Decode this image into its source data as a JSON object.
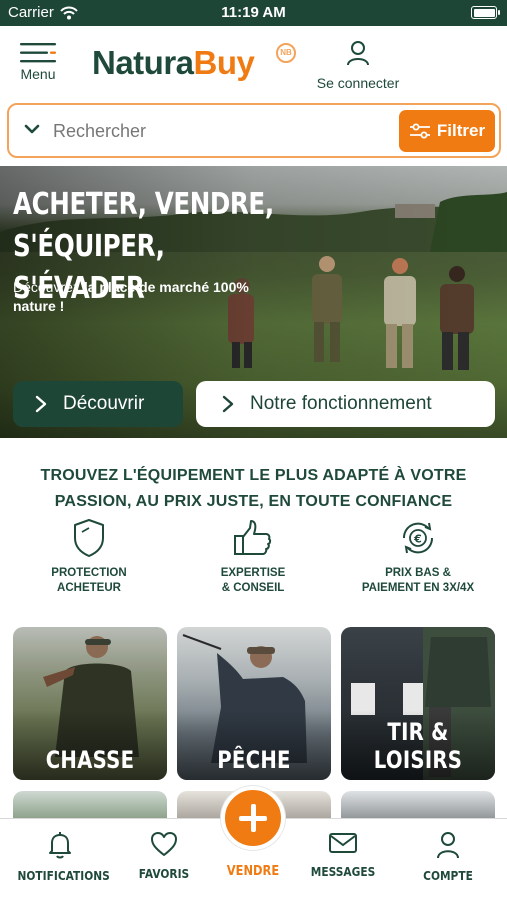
{
  "status_bar": {
    "carrier": "Carrier",
    "time": "11:19 AM",
    "battery_level": 1.0
  },
  "header": {
    "menu_label": "Menu",
    "logo_part1": "Natura",
    "logo_part2": "Buy",
    "logo_badge": "NB",
    "login_label": "Se connecter"
  },
  "search": {
    "placeholder": "Rechercher",
    "value": "",
    "filter_label": "Filtrer"
  },
  "hero": {
    "title_line1": "ACHETER, VENDRE,",
    "title_line2": "S'ÉQUIPER, S'ÉVADER",
    "subtitle_plain": "Découvrez ",
    "subtitle_bold": "la place de marché 100% nature !",
    "btn_discover": "Découvrir",
    "btn_how_it_works": "Notre fonctionnement"
  },
  "tagline": "TROUVEZ L'ÉQUIPEMENT LE PLUS ADAPTÉ À VOTRE PASSION, AU PRIX JUSTE, EN TOUTE CONFIANCE",
  "features": [
    {
      "icon": "shield-icon",
      "label": "PROTECTION\nACHETEUR"
    },
    {
      "icon": "thumbs-up-icon",
      "label": "EXPERTISE\n& CONSEIL"
    },
    {
      "icon": "euro-cycle-icon",
      "label": "PRIX BAS &\nPAIEMENT EN 3X/4X"
    }
  ],
  "categories": [
    {
      "label": "CHASSE"
    },
    {
      "label": "PÊCHE"
    },
    {
      "label": "TIR & LOISIRS"
    }
  ],
  "tabbar": {
    "notifications": "NOTIFICATIONS",
    "favorites": "FAVORIS",
    "sell": "VENDRE",
    "messages": "MESSAGES",
    "account": "COMPTE"
  },
  "colors": {
    "brand_green": "#1e4636",
    "brand_orange": "#f07b13"
  }
}
